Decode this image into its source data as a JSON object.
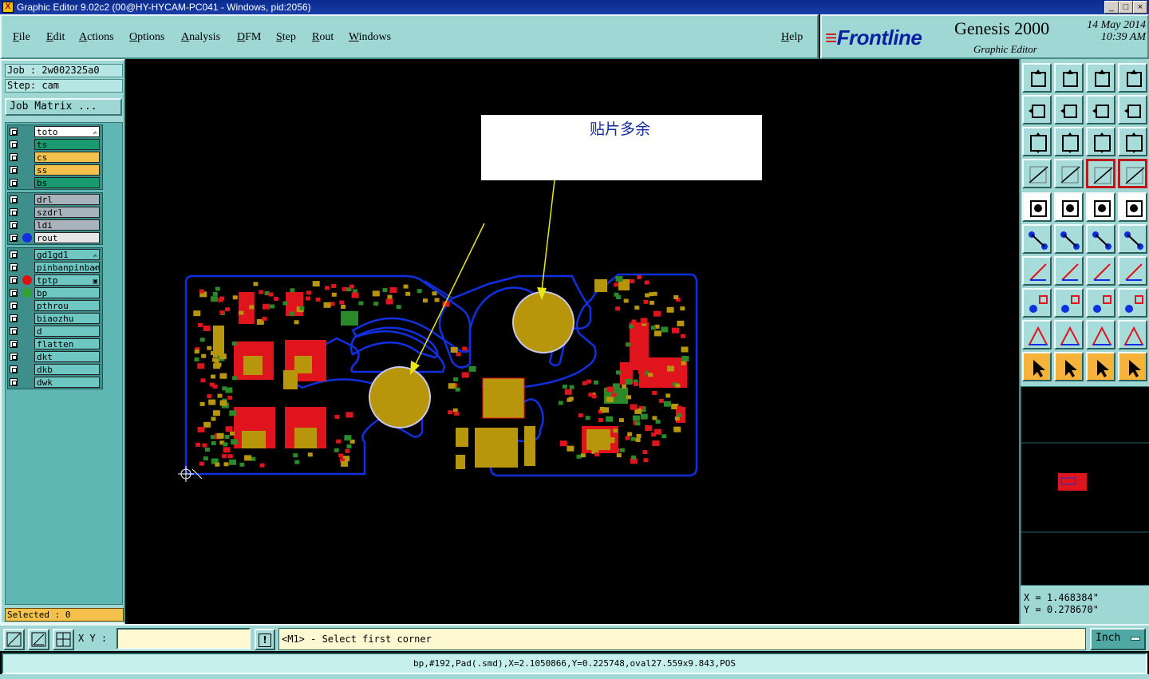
{
  "window": {
    "title": "Graphic Editor 9.02c2 (00@HY-HYCAM-PC041 - Windows, pid:2056)",
    "app_icon": "X"
  },
  "menu": {
    "items": [
      "File",
      "Edit",
      "Actions",
      "Options",
      "Analysis",
      "DFM",
      "Step",
      "Rout",
      "Windows"
    ],
    "help": "Help"
  },
  "logo": {
    "brand": "Frontline",
    "product": "Genesis 2000",
    "subtitle": "Graphic Editor",
    "date": "14 May 2014",
    "time": "10:39 AM"
  },
  "job": {
    "job_line": "Job : 2w002325a0",
    "step_line": "Step: cam",
    "matrix_button": "Job Matrix ..."
  },
  "layers": [
    {
      "name": "to",
      "color": "#ffffff",
      "mark": "✍"
    },
    {
      "name": "ts",
      "color": "#1a9a70"
    },
    {
      "name": "cs",
      "color": "#f4c24c"
    },
    {
      "name": "ss",
      "color": "#f4c24c"
    },
    {
      "name": "bs",
      "color": "#1a9a70"
    },
    {
      "name": "drl",
      "color": "#a9b3bb"
    },
    {
      "name": "szdrl",
      "color": "#a9b3bb"
    },
    {
      "name": "ldi",
      "color": "#a9b3bb"
    },
    {
      "name": "rout",
      "color": "#e6e6e6",
      "dot": "#1030e0"
    },
    {
      "name": "gd1",
      "color": "#6fc7c3",
      "mark": "✍"
    },
    {
      "name": "pinban",
      "color": "#6fc7c3",
      "mark": "✍"
    },
    {
      "name": "tp",
      "color": "#6fc7c3",
      "dot": "#e01010",
      "mark": "▣"
    },
    {
      "name": "bp",
      "color": "#6fc7c3",
      "dot": "#30a030"
    },
    {
      "name": "pthrou",
      "color": "#6fc7c3"
    },
    {
      "name": "biaozhu",
      "color": "#6fc7c3"
    },
    {
      "name": "d",
      "color": "#6fc7c3"
    },
    {
      "name": "flatten",
      "color": "#6fc7c3"
    },
    {
      "name": "dkt",
      "color": "#6fc7c3"
    },
    {
      "name": "dkb",
      "color": "#6fc7c3"
    },
    {
      "name": "dwk",
      "color": "#6fc7c3"
    }
  ],
  "selected": "Selected : 0",
  "annotation": {
    "text": "贴片多余"
  },
  "coords": {
    "x": "X = 1.468384\"",
    "y": "Y = 0.278670\""
  },
  "bottom": {
    "xy_label": "X Y :",
    "xy_value": "",
    "excl": "!",
    "prompt": "<M1> - Select first corner",
    "unit": "Inch",
    "status": "bp,#192,Pad(.smd),X=2.1050866,Y=0.225748,oval27.559x9.843,POS"
  },
  "colors": {
    "panel": "#9fd7d5",
    "copper_gold": "#b8960c",
    "pad_red": "#e0141c",
    "pad_green": "#2a8a2a",
    "outline_blue": "#1030e0",
    "arrow_yellow": "#e8e810"
  },
  "tools": [
    "step-up-icon",
    "step-down-icon",
    "home-icon",
    "split-window-icon",
    "zoom-in-icon",
    "zoom-out-icon",
    "swap-icon",
    "redraw-icon",
    "fit-icon",
    "center-icon",
    "one-to-one-icon",
    "help-icon",
    "measure-icon",
    "grid-icon",
    "snap-icon",
    "snap-alt-icon",
    "pad-icon",
    "line-icon",
    "ruler-icon",
    "circle-icon",
    "connect-icon",
    "cross-icon",
    "move-icon",
    "move-alt-icon",
    "angle-icon",
    "slash-icon",
    "rotate-icon",
    "mirror-icon",
    "copy-icon",
    "divide-icon",
    "width-icon",
    "group-icon",
    "triangle-icon",
    "triangle-alt-icon",
    "arch-icon",
    "arch-alt-icon",
    "select-icon",
    "select-box-icon",
    "select-net-icon",
    "select-path-icon"
  ]
}
